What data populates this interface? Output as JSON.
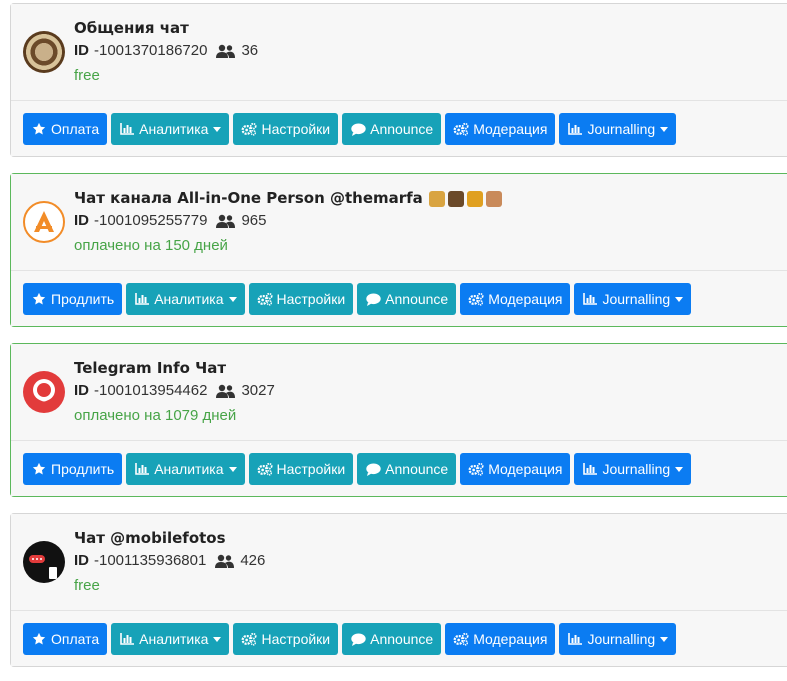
{
  "chats": [
    {
      "title": "Общения чат",
      "id_label": "ID",
      "id": "-1001370186720",
      "members": "36",
      "status": "free",
      "buttons": [
        "Оплата",
        "Аналитика",
        "Настройки",
        "Announce",
        "Модерация",
        "Journalling"
      ]
    },
    {
      "title": "Чат канала All-in-One Person @themarfa",
      "id_label": "ID",
      "id": "-1001095255779",
      "members": "965",
      "status": "оплачено на 150 дней",
      "buttons": [
        "Продлить",
        "Аналитика",
        "Настройки",
        "Announce",
        "Модерация",
        "Journalling"
      ]
    },
    {
      "title": "Telegram Info Чат",
      "id_label": "ID",
      "id": "-1001013954462",
      "members": "3027",
      "status": "оплачено на 1079 дней",
      "buttons": [
        "Продлить",
        "Аналитика",
        "Настройки",
        "Announce",
        "Модерация",
        "Journalling"
      ]
    },
    {
      "title": "Чат @mobilefotos",
      "id_label": "ID",
      "id": "-1001135936801",
      "members": "426",
      "status": "free",
      "buttons": [
        "Оплата",
        "Аналитика",
        "Настройки",
        "Announce",
        "Модерация",
        "Journalling"
      ]
    }
  ],
  "colors": {
    "primary": "#0b7cf2",
    "info": "#17a2b8",
    "success": "#47a447",
    "paid_border": "#5cb85c"
  },
  "icons": {
    "pay": "star-icon",
    "analytics": "bar-chart-icon",
    "settings": "cogs-icon",
    "announce": "comment-icon",
    "moderation": "cogs-icon",
    "journalling": "bar-chart-icon",
    "members": "users-icon"
  }
}
